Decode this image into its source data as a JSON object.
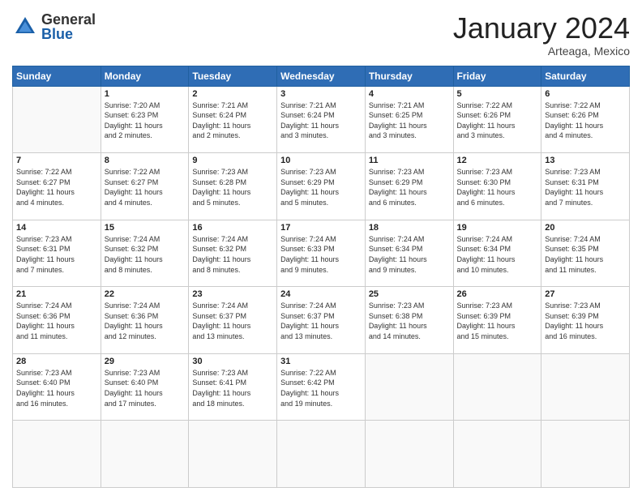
{
  "header": {
    "logo_general": "General",
    "logo_blue": "Blue",
    "month_title": "January 2024",
    "location": "Arteaga, Mexico"
  },
  "weekdays": [
    "Sunday",
    "Monday",
    "Tuesday",
    "Wednesday",
    "Thursday",
    "Friday",
    "Saturday"
  ],
  "days": [
    {
      "num": "",
      "info": ""
    },
    {
      "num": "1",
      "info": "Sunrise: 7:20 AM\nSunset: 6:23 PM\nDaylight: 11 hours\nand 2 minutes."
    },
    {
      "num": "2",
      "info": "Sunrise: 7:21 AM\nSunset: 6:24 PM\nDaylight: 11 hours\nand 2 minutes."
    },
    {
      "num": "3",
      "info": "Sunrise: 7:21 AM\nSunset: 6:24 PM\nDaylight: 11 hours\nand 3 minutes."
    },
    {
      "num": "4",
      "info": "Sunrise: 7:21 AM\nSunset: 6:25 PM\nDaylight: 11 hours\nand 3 minutes."
    },
    {
      "num": "5",
      "info": "Sunrise: 7:22 AM\nSunset: 6:26 PM\nDaylight: 11 hours\nand 3 minutes."
    },
    {
      "num": "6",
      "info": "Sunrise: 7:22 AM\nSunset: 6:26 PM\nDaylight: 11 hours\nand 4 minutes."
    },
    {
      "num": "7",
      "info": "Sunrise: 7:22 AM\nSunset: 6:27 PM\nDaylight: 11 hours\nand 4 minutes."
    },
    {
      "num": "8",
      "info": "Sunrise: 7:22 AM\nSunset: 6:27 PM\nDaylight: 11 hours\nand 4 minutes."
    },
    {
      "num": "9",
      "info": "Sunrise: 7:23 AM\nSunset: 6:28 PM\nDaylight: 11 hours\nand 5 minutes."
    },
    {
      "num": "10",
      "info": "Sunrise: 7:23 AM\nSunset: 6:29 PM\nDaylight: 11 hours\nand 5 minutes."
    },
    {
      "num": "11",
      "info": "Sunrise: 7:23 AM\nSunset: 6:29 PM\nDaylight: 11 hours\nand 6 minutes."
    },
    {
      "num": "12",
      "info": "Sunrise: 7:23 AM\nSunset: 6:30 PM\nDaylight: 11 hours\nand 6 minutes."
    },
    {
      "num": "13",
      "info": "Sunrise: 7:23 AM\nSunset: 6:31 PM\nDaylight: 11 hours\nand 7 minutes."
    },
    {
      "num": "14",
      "info": "Sunrise: 7:23 AM\nSunset: 6:31 PM\nDaylight: 11 hours\nand 7 minutes."
    },
    {
      "num": "15",
      "info": "Sunrise: 7:24 AM\nSunset: 6:32 PM\nDaylight: 11 hours\nand 8 minutes."
    },
    {
      "num": "16",
      "info": "Sunrise: 7:24 AM\nSunset: 6:32 PM\nDaylight: 11 hours\nand 8 minutes."
    },
    {
      "num": "17",
      "info": "Sunrise: 7:24 AM\nSunset: 6:33 PM\nDaylight: 11 hours\nand 9 minutes."
    },
    {
      "num": "18",
      "info": "Sunrise: 7:24 AM\nSunset: 6:34 PM\nDaylight: 11 hours\nand 9 minutes."
    },
    {
      "num": "19",
      "info": "Sunrise: 7:24 AM\nSunset: 6:34 PM\nDaylight: 11 hours\nand 10 minutes."
    },
    {
      "num": "20",
      "info": "Sunrise: 7:24 AM\nSunset: 6:35 PM\nDaylight: 11 hours\nand 11 minutes."
    },
    {
      "num": "21",
      "info": "Sunrise: 7:24 AM\nSunset: 6:36 PM\nDaylight: 11 hours\nand 11 minutes."
    },
    {
      "num": "22",
      "info": "Sunrise: 7:24 AM\nSunset: 6:36 PM\nDaylight: 11 hours\nand 12 minutes."
    },
    {
      "num": "23",
      "info": "Sunrise: 7:24 AM\nSunset: 6:37 PM\nDaylight: 11 hours\nand 13 minutes."
    },
    {
      "num": "24",
      "info": "Sunrise: 7:24 AM\nSunset: 6:37 PM\nDaylight: 11 hours\nand 13 minutes."
    },
    {
      "num": "25",
      "info": "Sunrise: 7:23 AM\nSunset: 6:38 PM\nDaylight: 11 hours\nand 14 minutes."
    },
    {
      "num": "26",
      "info": "Sunrise: 7:23 AM\nSunset: 6:39 PM\nDaylight: 11 hours\nand 15 minutes."
    },
    {
      "num": "27",
      "info": "Sunrise: 7:23 AM\nSunset: 6:39 PM\nDaylight: 11 hours\nand 16 minutes."
    },
    {
      "num": "28",
      "info": "Sunrise: 7:23 AM\nSunset: 6:40 PM\nDaylight: 11 hours\nand 16 minutes."
    },
    {
      "num": "29",
      "info": "Sunrise: 7:23 AM\nSunset: 6:40 PM\nDaylight: 11 hours\nand 17 minutes."
    },
    {
      "num": "30",
      "info": "Sunrise: 7:23 AM\nSunset: 6:41 PM\nDaylight: 11 hours\nand 18 minutes."
    },
    {
      "num": "31",
      "info": "Sunrise: 7:22 AM\nSunset: 6:42 PM\nDaylight: 11 hours\nand 19 minutes."
    },
    {
      "num": "",
      "info": ""
    },
    {
      "num": "",
      "info": ""
    },
    {
      "num": "",
      "info": ""
    },
    {
      "num": "",
      "info": ""
    },
    {
      "num": "",
      "info": ""
    }
  ]
}
